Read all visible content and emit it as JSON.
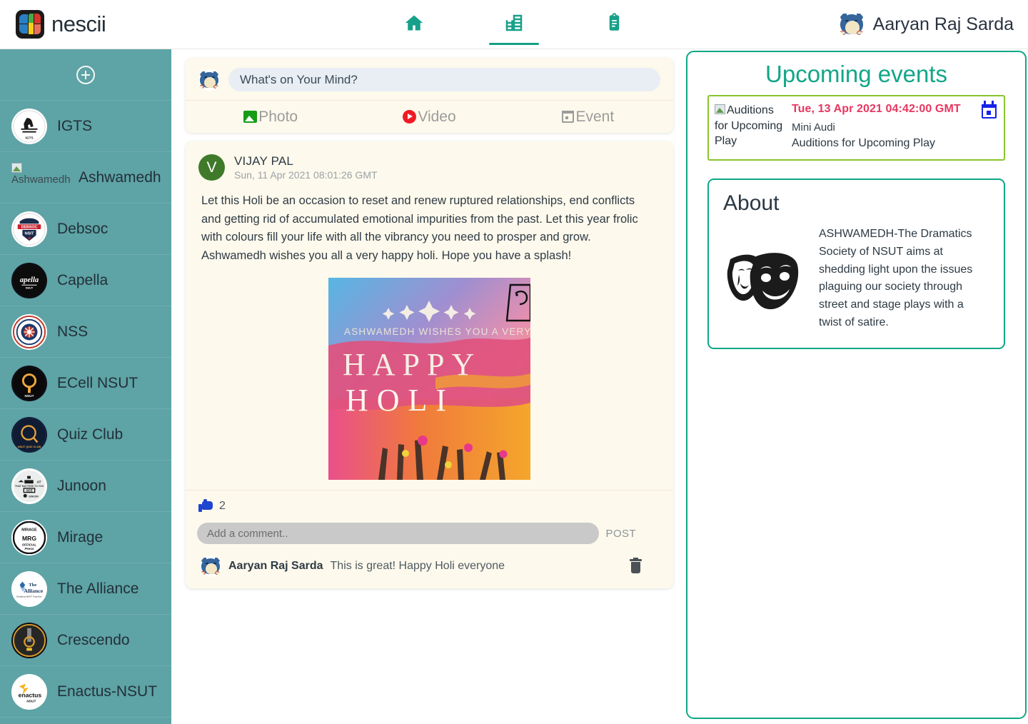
{
  "brand": {
    "name": "nescii",
    "logo_icon": "nescii-logo-icon"
  },
  "nav": [
    {
      "icon": "home-icon",
      "label": "Home",
      "active": false
    },
    {
      "icon": "building-icon",
      "label": "Societies",
      "active": true
    },
    {
      "icon": "clipboard-icon",
      "label": "Notices",
      "active": false
    }
  ],
  "user": {
    "name": "Aaryan Raj Sarda",
    "avatar_icon": "user-avatar"
  },
  "sidebar": {
    "add_label": "+",
    "add_icon": "plus-circle-icon",
    "items": [
      {
        "label": "IGTS",
        "logo": "igts-logo",
        "broken": false
      },
      {
        "label": "Ashwamedh",
        "logo": "ashwamedh-logo",
        "broken": true,
        "alt": "Ashwamedh"
      },
      {
        "label": "Debsoc",
        "logo": "debsoc-logo",
        "broken": false
      },
      {
        "label": "Capella",
        "logo": "capella-logo",
        "broken": false
      },
      {
        "label": "NSS",
        "logo": "nss-logo",
        "broken": false
      },
      {
        "label": "ECell NSUT",
        "logo": "ecell-logo",
        "broken": false
      },
      {
        "label": "Quiz Club",
        "logo": "quizclub-logo",
        "broken": false
      },
      {
        "label": "Junoon",
        "logo": "junoon-logo",
        "broken": false
      },
      {
        "label": "Mirage",
        "logo": "mirage-logo",
        "broken": false
      },
      {
        "label": "The Alliance",
        "logo": "alliance-logo",
        "broken": false
      },
      {
        "label": "Crescendo",
        "logo": "crescendo-logo",
        "broken": false
      },
      {
        "label": "Enactus-NSUT",
        "logo": "enactus-logo",
        "broken": false
      }
    ]
  },
  "composer": {
    "placeholder": "What's on Your Mind?",
    "value": "",
    "actions": [
      {
        "label": "Photo",
        "icon": "photo-icon",
        "color": "#159c16"
      },
      {
        "label": "Video",
        "icon": "video-icon",
        "color": "#ef1b24"
      },
      {
        "label": "Event",
        "icon": "event-calendar-icon",
        "color": "#9c9c9c"
      }
    ]
  },
  "post": {
    "author": "VIJAY PAL",
    "author_initial": "V",
    "timestamp": "Sun, 11 Apr 2021 08:01:26 GMT",
    "text": "Let this Holi be an occasion to reset and renew ruptured relationships, end conflicts and getting rid of accumulated emotional impurities from the past. Let this year frolic with colours fill your life with all the vibrancy you need to prosper and grow. Ashwamedh wishes you all a very happy holi. Hope you have a splash!",
    "image": {
      "alt": "Happy Holi poster",
      "headline": "ASHWAMEDH WISHES YOU A VERY",
      "title_line_1": "HAPPY",
      "title_line_2": "HOLI"
    },
    "like_count": "2",
    "like_icon": "thumbs-up-icon",
    "comment_placeholder": "Add a comment..",
    "comment_value": "",
    "post_button": "POST",
    "comments": [
      {
        "author": "Aaryan Raj Sarda",
        "text": "This is great! Happy Holi everyone",
        "delete_icon": "trash-icon"
      }
    ]
  },
  "right": {
    "events_title": "Upcoming events",
    "events": [
      {
        "thumb_alt": "Auditions for Upcoming Play",
        "date": "Tue, 13 Apr 2021 04:42:00 GMT",
        "venue": "Mini Audi",
        "name": "Auditions for Upcoming Play",
        "calendar_icon": "calendar-add-icon"
      }
    ],
    "about_title": "About",
    "about_icon": "theatre-masks-icon",
    "about_text": "ASHWAMEDH-The Dramatics Society of NSUT aims at shedding light upon the issues plaguing our society through street and stage plays with a twist of satire."
  },
  "colors": {
    "teal_accent": "#13a687",
    "sidebar_bg": "#5ea3a5",
    "card_bg": "#fdf9ec",
    "event_border": "#8ac52c",
    "event_date": "#e8365f",
    "like_blue": "#1e46d0"
  }
}
